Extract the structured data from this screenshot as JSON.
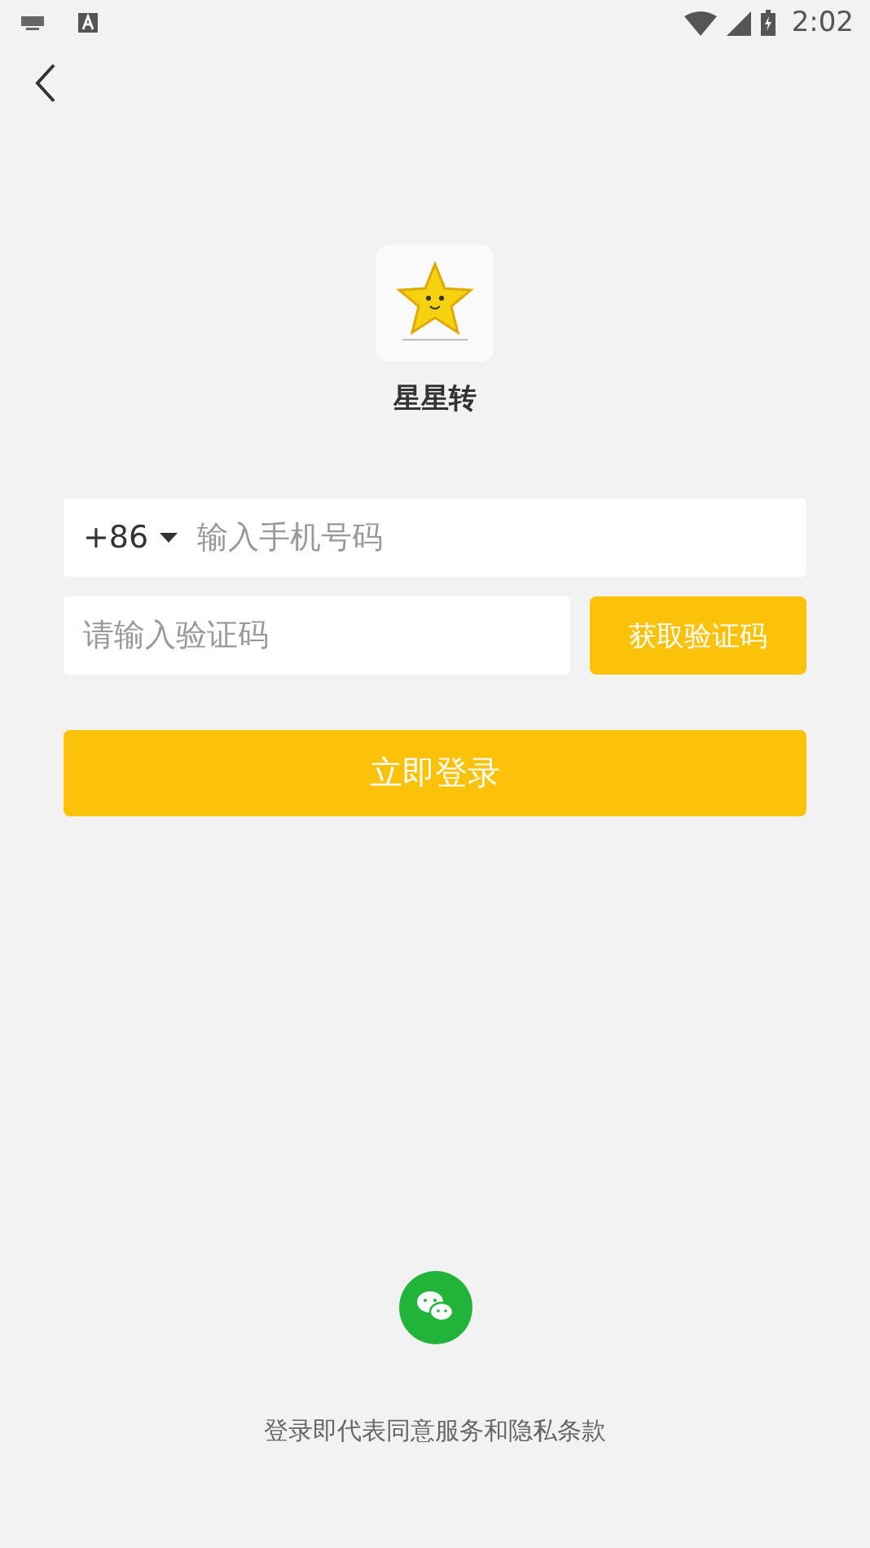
{
  "status_bar": {
    "time": "2:02"
  },
  "app": {
    "name": "星星转"
  },
  "phone": {
    "country_code": "+86",
    "placeholder": "输入手机号码"
  },
  "code": {
    "placeholder": "请输入验证码",
    "button": "获取验证码"
  },
  "login_button": "立即登录",
  "terms": "登录即代表同意服务和隐私条款"
}
